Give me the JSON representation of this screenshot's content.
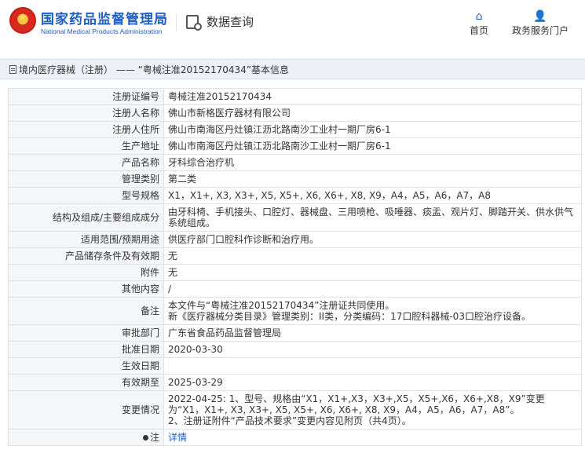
{
  "header": {
    "brand_cn": "国家药品监督管理局",
    "brand_en": "National Medical Products Administration",
    "query_label": "数据查询",
    "nav_home": "首页",
    "nav_gov": "政务服务门户"
  },
  "breadcrumb": "境内医疗器械（注册） —— “粤械注准20152170434”基本信息",
  "rows": [
    {
      "label": "注册证编号",
      "value": "粤械注准20152170434"
    },
    {
      "label": "注册人名称",
      "value": "佛山市新格医疗器材有限公司"
    },
    {
      "label": "注册人住所",
      "value": "佛山市南海区丹灶镇江沥北路南沙工业村一期厂房6-1"
    },
    {
      "label": "生产地址",
      "value": "佛山市南海区丹灶镇江沥北路南沙工业村一期厂房6-1"
    },
    {
      "label": "产品名称",
      "value": "牙科综合治疗机"
    },
    {
      "label": "管理类别",
      "value": "第二类"
    },
    {
      "label": "型号规格",
      "value": "X1，X1+, X3, X3+, X5, X5+, X6, X6+, X8, X9，A4，A5，A6，A7，A8"
    },
    {
      "label": "结构及组成/主要组成成分",
      "value": "由牙科椅、手机接头、口腔灯、器械盘、三用喷枪、吸唾器、痰盂、观片灯、脚踏开关、供水供气系统组成。"
    },
    {
      "label": "适用范围/预期用途",
      "value": "供医疗部门口腔科作诊断和治疗用。"
    },
    {
      "label": "产品储存条件及有效期",
      "value": "无"
    },
    {
      "label": "附件",
      "value": "无"
    },
    {
      "label": "其他内容",
      "value": "/"
    },
    {
      "label": "备注",
      "value": "本文件与“粤械注准20152170434”注册证共同使用。\n新《医疗器械分类目录》管理类别：II类，分类编码：17口腔科器械-03口腔治疗设备。"
    },
    {
      "label": "审批部门",
      "value": "广东省食品药品监督管理局"
    },
    {
      "label": "批准日期",
      "value": "2020-03-30"
    },
    {
      "label": "生效日期",
      "value": ""
    },
    {
      "label": "有效期至",
      "value": "2025-03-29"
    },
    {
      "label": "变更情况",
      "value": "2022-04-25: 1、型号、规格由“X1，X1+,X3，X3+,X5，X5+,X6，X6+,X8，X9”变更为“X1，X1+, X3, X3+, X5, X5+, X6, X6+, X8, X9，A4，A5，A6，A7，A8”。\n2、注册证附件“产品技术要求”变更内容见附页（共4页）。"
    }
  ],
  "note": {
    "label": "注",
    "link": "详情"
  },
  "colors": {
    "brand_blue": "#1e5fbf",
    "label_bg": "#f5f6f8",
    "border": "#dfe3e8"
  }
}
